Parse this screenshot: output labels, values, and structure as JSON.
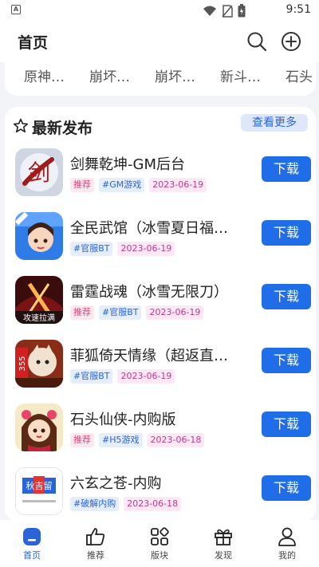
{
  "status_bar": {
    "time": "9:51",
    "app_badge": "A"
  },
  "header": {
    "title": "首页"
  },
  "tabs": [
    {
      "label": "原神…"
    },
    {
      "label": "崩坏…"
    },
    {
      "label": "崩坏…"
    },
    {
      "label": "新斗…"
    },
    {
      "label": "石头"
    }
  ],
  "section": {
    "title": "最新发布",
    "more_label": "查看更多"
  },
  "download_label": "下载",
  "games": [
    {
      "name": "剑舞乾坤-GM后台",
      "tags": [
        {
          "type": "rec",
          "text": "推荐"
        },
        {
          "type": "cat",
          "text": "#GM游戏"
        },
        {
          "type": "date",
          "text": "2023-06-19"
        }
      ]
    },
    {
      "name": "全民武馆（冰雪夏日福…",
      "tags": [
        {
          "type": "cat",
          "text": "#官服BT"
        },
        {
          "type": "date",
          "text": "2023-06-19"
        }
      ]
    },
    {
      "name": "雷霆战魂（冰雪无限刀）",
      "tags": [
        {
          "type": "rec",
          "text": "推荐"
        },
        {
          "type": "cat",
          "text": "#官服BT"
        },
        {
          "type": "date",
          "text": "2023-06-19"
        }
      ]
    },
    {
      "name": "菲狐倚天情缘（超返直…",
      "tags": [
        {
          "type": "cat",
          "text": "#官服BT"
        },
        {
          "type": "date",
          "text": "2023-06-19"
        }
      ]
    },
    {
      "name": "石头仙侠-内购版",
      "tags": [
        {
          "type": "rec",
          "text": "推荐"
        },
        {
          "type": "cat",
          "text": "#H5游戏"
        },
        {
          "type": "date",
          "text": "2023-06-18"
        }
      ]
    },
    {
      "name": "六玄之苍-内购",
      "tags": [
        {
          "type": "cat",
          "text": "#破解内购"
        },
        {
          "type": "date",
          "text": "2023-06-18"
        }
      ]
    }
  ],
  "game_icons": [
    {
      "icon": "sword-calligraphy-icon",
      "text": "剑"
    },
    {
      "icon": "girl-character-icon",
      "text": ""
    },
    {
      "icon": "warrior-icon",
      "text": "攻速拉满"
    },
    {
      "icon": "fox-warrior-icon",
      "text": "355"
    },
    {
      "icon": "maiden-character-icon",
      "text": ""
    },
    {
      "icon": "gift-logo-icon",
      "text": "秋吉留"
    }
  ],
  "bottom_nav": [
    {
      "label": "首页",
      "icon": "home-icon",
      "active": true
    },
    {
      "label": "推荐",
      "icon": "thumbs-up-icon",
      "active": false
    },
    {
      "label": "版块",
      "icon": "grid-icon",
      "active": false
    },
    {
      "label": "发现",
      "icon": "gift-icon",
      "active": false
    },
    {
      "label": "我的",
      "icon": "user-icon",
      "active": false
    }
  ],
  "colors": {
    "accent": "#1f6ee8",
    "background": "#f3f4f8",
    "tag_rec": "#e0457b",
    "tag_cat": "#2a64d8"
  }
}
